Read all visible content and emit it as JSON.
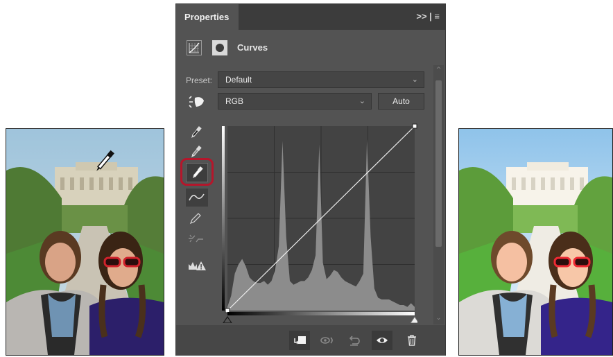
{
  "panel": {
    "tab_label": "Properties",
    "menu_icons": ">> | ≡",
    "title": "Curves",
    "preset_label": "Preset:",
    "preset_value": "Default",
    "channel_value": "RGB",
    "auto_label": "Auto"
  },
  "tools": [
    {
      "name": "sample-black-point-icon"
    },
    {
      "name": "sample-gray-point-icon"
    },
    {
      "name": "sample-white-point-icon",
      "selected": true
    },
    {
      "name": "edit-points-curve-icon"
    },
    {
      "name": "draw-curve-pencil-icon"
    },
    {
      "name": "smooth-curve-icon"
    },
    {
      "name": "clipping-warning-icon"
    }
  ],
  "bottom_bar": [
    "clip-to-layer-icon",
    "view-previous-state-icon",
    "reset-icon",
    "visibility-eye-icon",
    "delete-trash-icon"
  ],
  "colors": {
    "highlight": "#b5162b",
    "panel_bg": "#535353"
  },
  "chart_data": {
    "type": "area",
    "xlim": [
      0,
      255
    ],
    "ylim": [
      0,
      1
    ],
    "histogram_x": [
      0,
      5,
      10,
      15,
      20,
      25,
      30,
      35,
      40,
      45,
      50,
      55,
      60,
      65,
      70,
      75,
      80,
      85,
      90,
      95,
      100,
      105,
      110,
      115,
      120,
      125,
      130,
      135,
      140,
      145,
      150,
      155,
      160,
      165,
      170,
      175,
      180,
      185,
      190,
      195,
      200,
      205,
      210,
      215,
      220,
      225,
      230,
      235,
      240,
      245,
      250,
      255
    ],
    "histogram_y": [
      0.02,
      0.08,
      0.2,
      0.25,
      0.28,
      0.24,
      0.18,
      0.16,
      0.15,
      0.15,
      0.16,
      0.14,
      0.16,
      0.22,
      0.35,
      0.92,
      0.4,
      0.16,
      0.14,
      0.15,
      0.16,
      0.16,
      0.18,
      0.22,
      0.3,
      0.9,
      0.26,
      0.17,
      0.19,
      0.22,
      0.21,
      0.18,
      0.16,
      0.15,
      0.14,
      0.13,
      0.16,
      0.2,
      0.93,
      0.4,
      0.12,
      0.07,
      0.06,
      0.06,
      0.06,
      0.05,
      0.04,
      0.03,
      0.03,
      0.02,
      0.04,
      0.02
    ],
    "curve_points": [
      [
        0,
        0
      ],
      [
        255,
        255
      ]
    ]
  }
}
